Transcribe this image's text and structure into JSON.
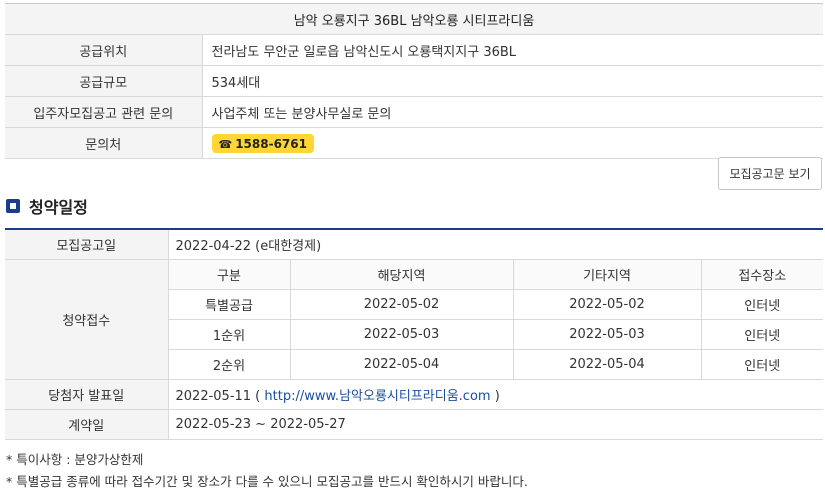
{
  "info": {
    "title": "남악 오룡지구 36BL 남악오룡 시티프라디움",
    "rows": [
      {
        "label": "공급위치",
        "value": "전라남도 무안군 일로읍 남악신도시 오룡택지지구 36BL"
      },
      {
        "label": "공급규모",
        "value": "534세대"
      },
      {
        "label": "입주자모집공고 관련 문의",
        "value": "사업주체 또는 분양사무실로 문의"
      },
      {
        "label": "문의처",
        "value": "1588-6761"
      }
    ],
    "phone_icon": "phone-icon"
  },
  "notice_button": "모집공고문 보기",
  "section_title": "청약일정",
  "schedule": {
    "announce_label": "모집공고일",
    "announce_value": "2022-04-22 (e대한경제)",
    "receipt_label": "청약접수",
    "receipt_headers": [
      "구분",
      "해당지역",
      "기타지역",
      "접수장소"
    ],
    "receipt_rows": [
      [
        "특별공급",
        "2022-05-02",
        "2022-05-02",
        "인터넷"
      ],
      [
        "1순위",
        "2022-05-03",
        "2022-05-03",
        "인터넷"
      ],
      [
        "2순위",
        "2022-05-04",
        "2022-05-04",
        "인터넷"
      ]
    ],
    "winner_label": "당첨자 발표일",
    "winner_date": "2022-05-11 (",
    "winner_link": "http://www.남악오룡시티프라디움.com",
    "winner_close": ")",
    "contract_label": "계약일",
    "contract_value": "2022-05-23 ~ 2022-05-27"
  },
  "notes": [
    "* 특이사항 : 분양가상한제",
    "* 특별공급 종류에 따라 접수기간 및 장소가 다를 수 있으니 모집공고를 반드시 확인하시기 바랍니다."
  ],
  "colors": {
    "accent": "#1a3e8f",
    "badge": "#ffd633",
    "link": "#1a4fa0"
  }
}
